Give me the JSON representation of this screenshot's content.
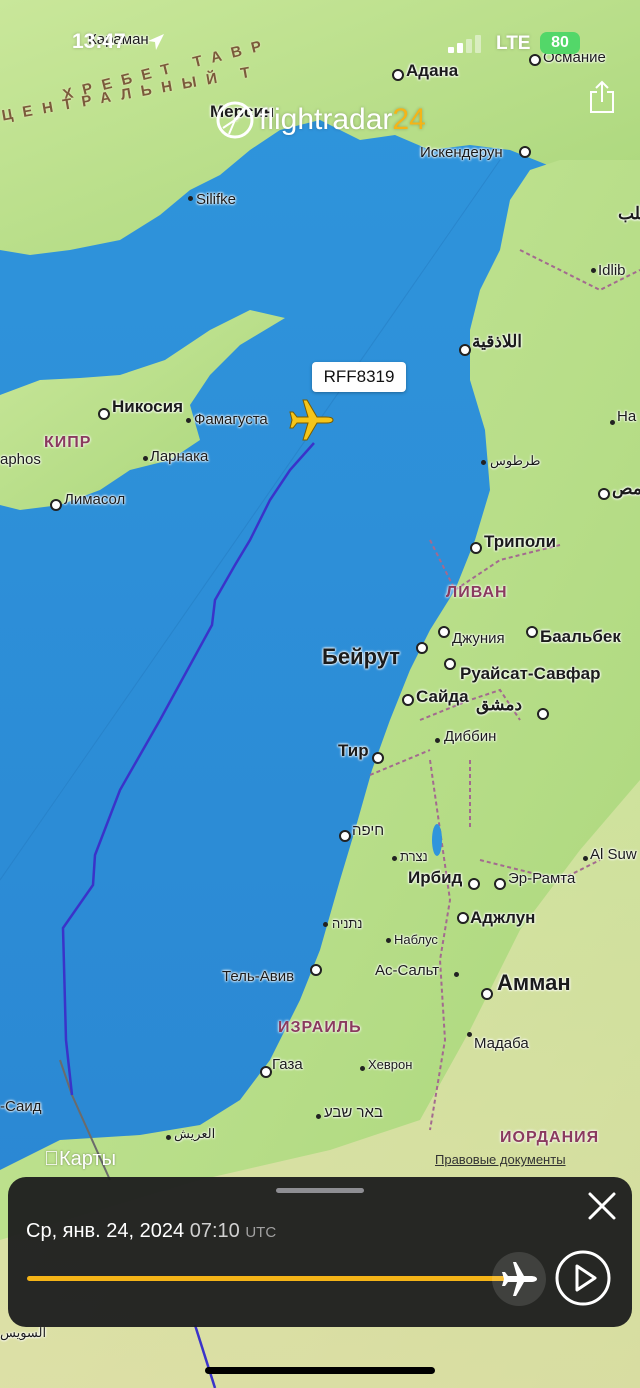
{
  "status_bar": {
    "time": "13:47",
    "network": "LTE",
    "battery": "80"
  },
  "app": {
    "logo_main": "flightradar",
    "logo_accent": "24"
  },
  "flight": {
    "callsign": "RFF8319"
  },
  "map": {
    "range_line_1": "ХРЕБЕТ ТАВР",
    "range_line_2": "ЦЕНТРАЛЬНЫЙ Т",
    "cities": {
      "adana": "Адана",
      "osmanie": "Османие",
      "karaman": "Караман",
      "mersin": "Мерсин",
      "silifke": "Silifke",
      "iskenderun": "Искендерун",
      "idlib": "Idlib",
      "alep": "حلب",
      "latakia": "اللاذقية",
      "nicosia": "Никосия",
      "famagusta": "Фамагуста",
      "larnaca": "Ларнака",
      "limassol": "Лимасол",
      "paphos": "aphos",
      "tartus": "طرطوس",
      "homs": "حمص",
      "hama": "На",
      "tripoli": "Триполи",
      "jounieh": "Джуния",
      "baalbek": "Баальбек",
      "beirut": "Бейрут",
      "rouaisset": "Руайсат-Савфар",
      "saida": "Сайда",
      "damascus": "دمشق",
      "tyre": "Тир",
      "dibbin": "Диббин",
      "haifa": "חיפה",
      "nazareth": "נצרת",
      "al_suw": "Al Suw",
      "irbid": "Ирбид",
      "ramtha": "Эр-Рамта",
      "netanya": "נתניה",
      "ajloun": "Аджлун",
      "nablus": "Наблус",
      "tel_aviv": "Тель-Авив",
      "salt": "Ас-Сальт",
      "amman": "Амман",
      "madaba": "Мадаба",
      "gaza": "Газа",
      "hebron": "Хеврон",
      "beersheba": "באר שבע",
      "port_said": "-Саид",
      "el_arish": "العريش",
      "suez": "السويس"
    },
    "countries": {
      "cyprus": "КИПР",
      "lebanon": "ЛИВАН",
      "israel": "ИЗРАИЛЬ",
      "jordan": "ИОРДАНИЯ"
    },
    "maps_brand": "Карты",
    "legal": "Правовые документы"
  },
  "playback": {
    "date": "Ср, янв. 24, 2024",
    "time": "07:10",
    "tz": "UTC",
    "progress": 0.97
  },
  "colors": {
    "sea": "#2e8fd6",
    "land": "#bfe28e",
    "track": "#3a33c9",
    "accent": "#f5b417",
    "aircraft": "#f5c51a"
  }
}
